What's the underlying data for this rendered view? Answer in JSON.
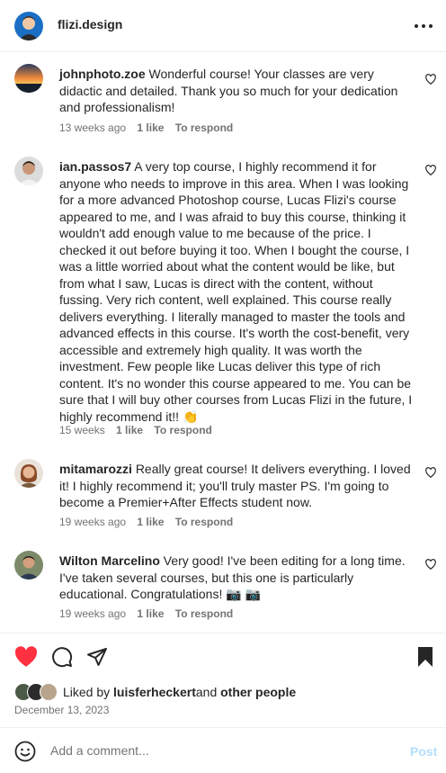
{
  "post": {
    "author": "flizi.design",
    "more_icon": "more-horizontal-icon"
  },
  "comments": [
    {
      "username": "johnphoto.zoe",
      "text": "Wonderful course! Your classes are very didactic and detailed. Thank you so much for your dedication and professionalism!",
      "time": "13 weeks ago",
      "likes": "1 like",
      "reply": "To respond"
    },
    {
      "username": "ian.passos7",
      "text": "A very top course, I highly recommend it for anyone who needs to improve in this area. When I was looking for a more advanced Photoshop course, Lucas Flizi's course appeared to me, and I was afraid to buy this course, thinking it wouldn't add enough value to me because of the price. I checked it out before buying it too. When I bought the course, I was a little worried about what the content would be like, but from what I saw, Lucas is direct with the content, without fussing. Very rich content, well explained. This course really delivers everything. I literally managed to master the tools and advanced effects in this course. It's worth the cost-benefit, very accessible and extremely high quality. It was worth the investment. Few people like Lucas deliver this type of rich content. It's no wonder this course appeared to me. You can be sure that I will buy other courses from Lucas Flizi in the future, I highly recommend it!! 👏",
      "time": "15 weeks",
      "likes": "1 like",
      "reply": "To respond"
    },
    {
      "username": "mitamarozzi",
      "text": "Really great course! It delivers everything. I loved it! I highly recommend it; you'll truly master PS. I'm going to become a Premier+After Effects student now.",
      "time": "19 weeks ago",
      "likes": "1 like",
      "reply": "To respond"
    },
    {
      "username": "Wilton Marcelino",
      "text": "Very good! I've been editing for a long time. I've taken several courses, but this one is particularly educational. Congratulations! 📷 📷",
      "time": "19 weeks ago",
      "likes": "1 like",
      "reply": "To respond"
    }
  ],
  "actions": {
    "like_icon": "heart-filled-icon",
    "comment_icon": "comment-bubble-icon",
    "share_icon": "paper-plane-icon",
    "save_icon": "bookmark-filled-icon",
    "like_color": "#ff3040"
  },
  "likes_summary": {
    "prefix": "Liked by",
    "user": "luisferheckert",
    "conjunction": "and",
    "others": "other people"
  },
  "date": "December 13, 2023",
  "composer": {
    "emoji_icon": "smiley-icon",
    "placeholder": "Add a comment...",
    "post_label": "Post",
    "post_color": "#b2dffc"
  }
}
